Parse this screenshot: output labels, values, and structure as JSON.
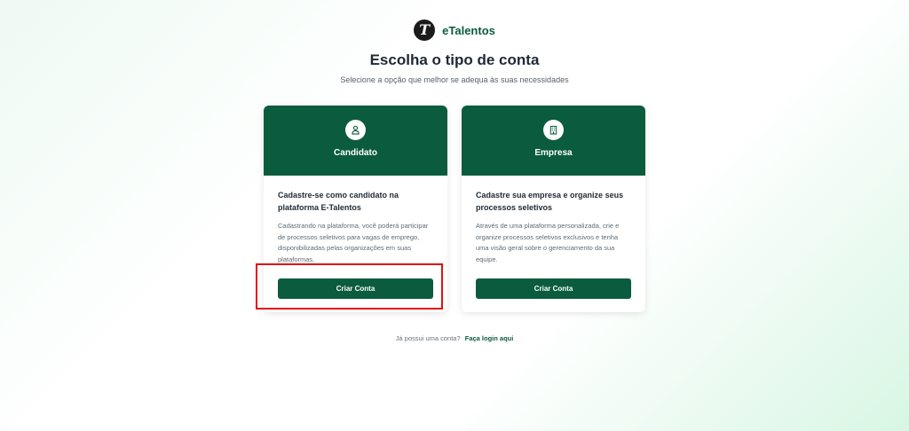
{
  "brand": {
    "name": "eTalentos",
    "logo_letter": "T"
  },
  "header": {
    "title": "Escolha o tipo de conta",
    "subtitle": "Selecione a opção que melhor se adequa às suas necessidades"
  },
  "cards": [
    {
      "icon": "user-icon",
      "title": "Candidato",
      "heading": "Cadastre-se como candidato na plataforma E-Talentos",
      "description": "Cadastrando na plataforma, você poderá participar de processos seletivos para vagas de emprego, disponibilizadas pelas organizações em suas plataformas.",
      "button": "Criar Conta"
    },
    {
      "icon": "building-icon",
      "title": "Empresa",
      "heading": "Cadastre sua empresa e organize seus processos seletivos",
      "description": "Através de uma plataforma personalizada, crie e organize processos seletivos exclusivos e tenha uma visão geral sobre o gerenciamento da sua equipe.",
      "button": "Criar Conta"
    }
  ],
  "footer": {
    "prompt": "Já possui uma conta?",
    "link": "Faça login aqui"
  },
  "colors": {
    "primary": "#0b5c3f",
    "highlight": "#e01010"
  }
}
